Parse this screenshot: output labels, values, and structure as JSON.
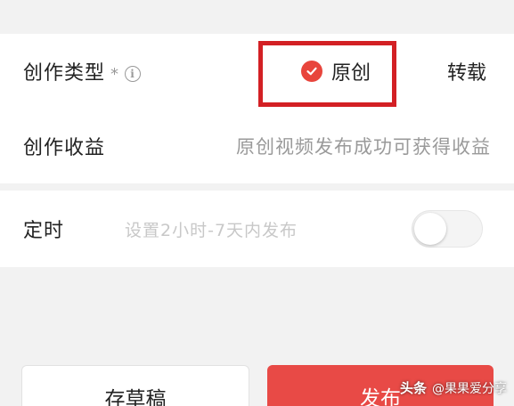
{
  "creation_type": {
    "label": "创作类型",
    "required_mark": "*",
    "info_icon": "info-icon",
    "options": [
      {
        "label": "原创",
        "selected": true
      },
      {
        "label": "转载",
        "selected": false
      }
    ]
  },
  "creation_earnings": {
    "label": "创作收益",
    "value": "原创视频发布成功可获得收益"
  },
  "timer": {
    "label": "定时",
    "placeholder": "设置2小时-7天内发布",
    "enabled": false
  },
  "actions": {
    "save_draft_label": "存草稿",
    "publish_label": "发布"
  },
  "watermark": {
    "app": "头条",
    "handle": "@果果爱分享"
  },
  "colors": {
    "accent": "#e84a46",
    "highlight_box": "#d32024"
  }
}
